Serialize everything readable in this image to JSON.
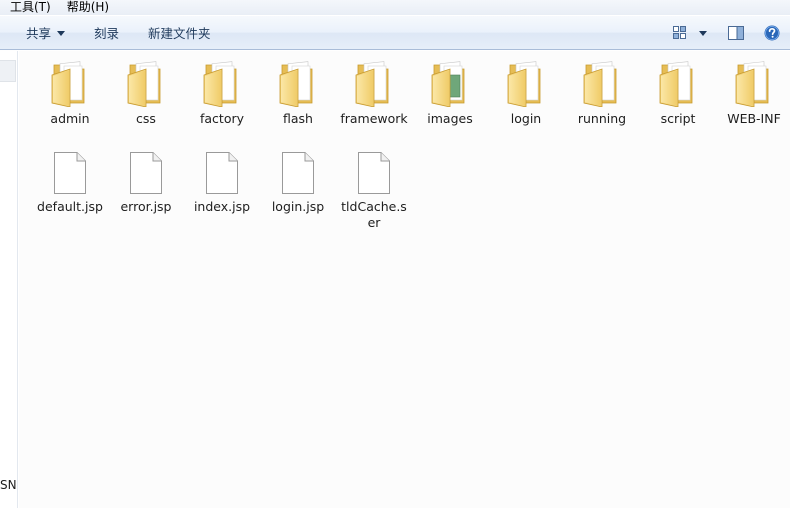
{
  "menubar": {
    "items": [
      "工具(T)",
      "帮助(H)"
    ]
  },
  "toolbar": {
    "share_label": "共享",
    "burn_label": "刻录",
    "new_folder_label": "新建文件夹"
  },
  "icons": {
    "view": "view-options-icon",
    "pane": "preview-pane-icon",
    "help": "help-icon",
    "folder": "folder-icon",
    "file": "file-icon"
  },
  "colors": {
    "toolbar_text": "#1e395b",
    "folder": "#f2d37c",
    "help_blue": "#2a67b8"
  },
  "nav": {
    "cut_text": "SN"
  },
  "folders": [
    {
      "name": "admin"
    },
    {
      "name": "css"
    },
    {
      "name": "factory"
    },
    {
      "name": "flash"
    },
    {
      "name": "framework"
    },
    {
      "name": "images"
    },
    {
      "name": "login"
    },
    {
      "name": "running"
    },
    {
      "name": "script"
    },
    {
      "name": "WEB-INF"
    }
  ],
  "files": [
    {
      "name": "default.jsp"
    },
    {
      "name": "error.jsp"
    },
    {
      "name": "index.jsp"
    },
    {
      "name": "login.jsp"
    },
    {
      "name": "tldCache.ser"
    }
  ]
}
